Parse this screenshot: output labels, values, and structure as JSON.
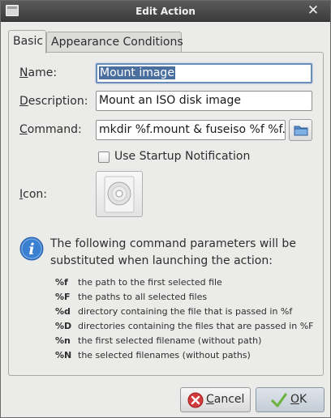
{
  "window": {
    "title": "Edit Action",
    "close_glyph": "✕"
  },
  "tabs": [
    {
      "label": "Basic",
      "active": true
    },
    {
      "label": "Appearance Conditions",
      "active": false
    }
  ],
  "form": {
    "name_label_mnemonic": "N",
    "name_label_rest": "ame:",
    "name_value": "Mount image",
    "description_label_mnemonic": "D",
    "description_label_rest": "escription:",
    "description_value": "Mount an ISO disk image",
    "command_label_mnemonic": "C",
    "command_label_rest": "ommand:",
    "command_value": "mkdir %f.mount & fuseiso %f %f.mount",
    "startup_notification_label": "Use Startup Notification",
    "startup_notification_checked": false,
    "icon_label_mnemonic": "I",
    "icon_label_rest": "con:",
    "icon_name": "cd-disc-icon"
  },
  "info": {
    "icon": "info-icon",
    "text": "The following command parameters will be substituted when launching the action:",
    "parameters": [
      {
        "key": "%f",
        "description": "the path to the first selected file"
      },
      {
        "key": "%F",
        "description": "the paths to all selected files"
      },
      {
        "key": "%d",
        "description": "directory containing the file that is passed in %f"
      },
      {
        "key": "%D",
        "description": "directories containing the files that are passed in %F"
      },
      {
        "key": "%n",
        "description": "the first selected filename (without path)"
      },
      {
        "key": "%N",
        "description": "the selected filenames (without paths)"
      }
    ]
  },
  "buttons": {
    "cancel_mnemonic": "C",
    "cancel_rest": "ancel",
    "ok_mnemonic": "O",
    "ok_rest": "K"
  },
  "colors": {
    "selection": "#4a6f9f",
    "info_blue": "#3b7fd0",
    "cancel_red": "#d23b3b",
    "ok_green": "#6db33f"
  }
}
